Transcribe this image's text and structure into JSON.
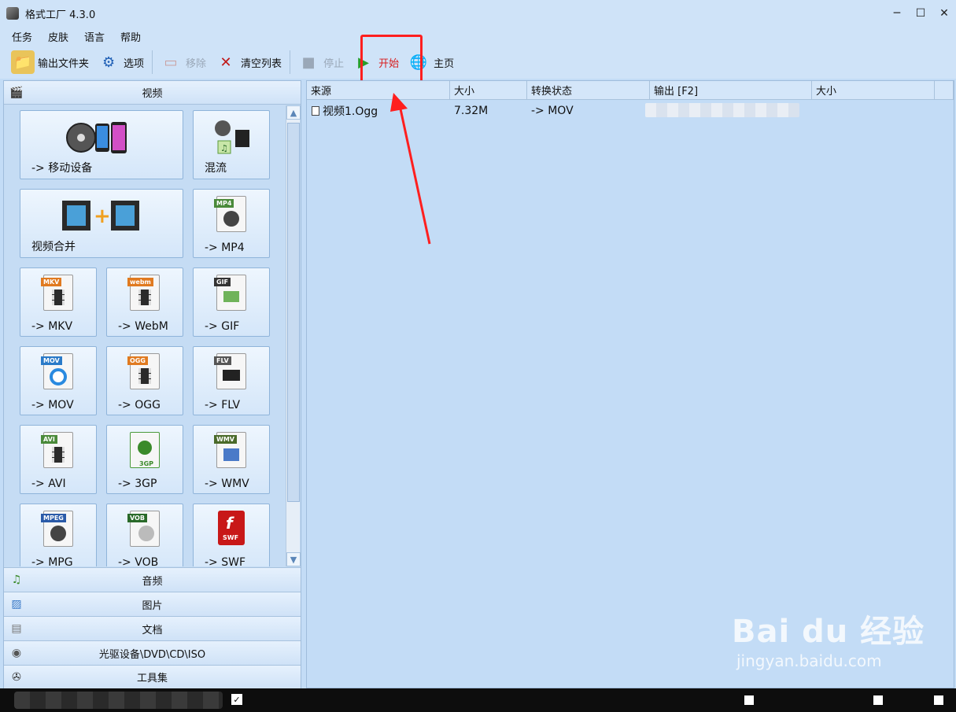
{
  "window": {
    "title": "格式工厂 4.3.0",
    "minimize": "─",
    "maximize": "☐",
    "close": "✕"
  },
  "menu": [
    "任务",
    "皮肤",
    "语言",
    "帮助"
  ],
  "toolbar": {
    "output_folder": "输出文件夹",
    "options": "选项",
    "remove": "移除",
    "clear_list": "清空列表",
    "stop": "停止",
    "start": "开始",
    "home": "主页"
  },
  "left": {
    "video_header": "视频",
    "tiles": [
      {
        "label": "-> 移动设备"
      },
      {
        "label": "混流"
      },
      {
        "label": "视频合并"
      },
      {
        "label": "-> MP4",
        "badge": "MP4"
      },
      {
        "label": "-> MKV",
        "badge": "MKV"
      },
      {
        "label": "-> WebM",
        "badge": "webm"
      },
      {
        "label": "-> GIF",
        "badge": "GIF"
      },
      {
        "label": "-> MOV",
        "badge": "MOV"
      },
      {
        "label": "-> OGG",
        "badge": "OGG"
      },
      {
        "label": "-> FLV",
        "badge": "FLV"
      },
      {
        "label": "-> AVI",
        "badge": "AVI"
      },
      {
        "label": "-> 3GP",
        "badge": "3GP"
      },
      {
        "label": "-> WMV",
        "badge": "WMV"
      },
      {
        "label": "-> MPG",
        "badge": "MPEG"
      },
      {
        "label": "-> VOB",
        "badge": "VOB"
      },
      {
        "label": "-> SWF",
        "badge": "SWF"
      }
    ],
    "categories": [
      "音频",
      "图片",
      "文档",
      "光驱设备\\DVD\\CD\\ISO",
      "工具集"
    ]
  },
  "table": {
    "headers": [
      "来源",
      "大小",
      "转换状态",
      "输出 [F2]",
      "大小"
    ],
    "rows": [
      {
        "source": "视频1.Ogg",
        "size": "7.32M",
        "status": "-> MOV"
      }
    ]
  },
  "watermark": {
    "main": "Bai du 经验",
    "sub": "jingyan.baidu.com"
  },
  "colors": {
    "highlight": "#ff1f1f",
    "start_text": "#d81e1e"
  }
}
